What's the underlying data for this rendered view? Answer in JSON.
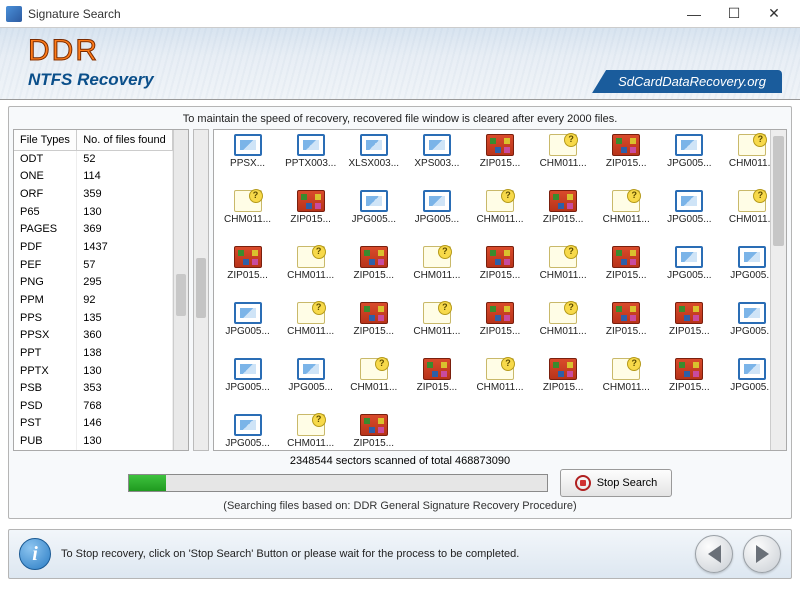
{
  "titlebar": {
    "title": "Signature Search"
  },
  "header": {
    "brand": "DDR",
    "subtitle": "NTFS Recovery",
    "site": "SdCardDataRecovery.org"
  },
  "status_line": "To maintain the speed of recovery, recovered file window is cleared after every 2000 files.",
  "file_types_table": {
    "headers": [
      "File Types",
      "No. of files found"
    ],
    "rows": [
      [
        "ODT",
        "52"
      ],
      [
        "ONE",
        "114"
      ],
      [
        "ORF",
        "359"
      ],
      [
        "P65",
        "130"
      ],
      [
        "PAGES",
        "369"
      ],
      [
        "PDF",
        "1437"
      ],
      [
        "PEF",
        "57"
      ],
      [
        "PNG",
        "295"
      ],
      [
        "PPM",
        "92"
      ],
      [
        "PPS",
        "135"
      ],
      [
        "PPSX",
        "360"
      ],
      [
        "PPT",
        "138"
      ],
      [
        "PPTX",
        "130"
      ],
      [
        "PSB",
        "353"
      ],
      [
        "PSD",
        "768"
      ],
      [
        "PST",
        "146"
      ],
      [
        "PUB",
        "130"
      ]
    ]
  },
  "file_grid": [
    {
      "t": "img",
      "l": "PPSX..."
    },
    {
      "t": "img",
      "l": "PPTX003..."
    },
    {
      "t": "img",
      "l": "XLSX003..."
    },
    {
      "t": "img",
      "l": "XPS003..."
    },
    {
      "t": "zip",
      "l": "ZIP015..."
    },
    {
      "t": "unk",
      "l": "CHM011..."
    },
    {
      "t": "zip",
      "l": "ZIP015..."
    },
    {
      "t": "img",
      "l": "JPG005..."
    },
    {
      "t": "unk",
      "l": "CHM011..."
    },
    {
      "t": "unk",
      "l": "CHM011..."
    },
    {
      "t": "zip",
      "l": "ZIP015..."
    },
    {
      "t": "img",
      "l": "JPG005..."
    },
    {
      "t": "img",
      "l": "JPG005..."
    },
    {
      "t": "unk",
      "l": "CHM011..."
    },
    {
      "t": "zip",
      "l": "ZIP015..."
    },
    {
      "t": "unk",
      "l": "CHM011..."
    },
    {
      "t": "img",
      "l": "JPG005..."
    },
    {
      "t": "unk",
      "l": "CHM011..."
    },
    {
      "t": "zip",
      "l": "ZIP015..."
    },
    {
      "t": "unk",
      "l": "CHM011..."
    },
    {
      "t": "zip",
      "l": "ZIP015..."
    },
    {
      "t": "unk",
      "l": "CHM011..."
    },
    {
      "t": "zip",
      "l": "ZIP015..."
    },
    {
      "t": "unk",
      "l": "CHM011..."
    },
    {
      "t": "zip",
      "l": "ZIP015..."
    },
    {
      "t": "img",
      "l": "JPG005..."
    },
    {
      "t": "img",
      "l": "JPG005..."
    },
    {
      "t": "img",
      "l": "JPG005..."
    },
    {
      "t": "unk",
      "l": "CHM011..."
    },
    {
      "t": "zip",
      "l": "ZIP015..."
    },
    {
      "t": "unk",
      "l": "CHM011..."
    },
    {
      "t": "zip",
      "l": "ZIP015..."
    },
    {
      "t": "unk",
      "l": "CHM011..."
    },
    {
      "t": "zip",
      "l": "ZIP015..."
    },
    {
      "t": "zip",
      "l": "ZIP015..."
    },
    {
      "t": "img",
      "l": "JPG005..."
    },
    {
      "t": "img",
      "l": "JPG005..."
    },
    {
      "t": "img",
      "l": "JPG005..."
    },
    {
      "t": "unk",
      "l": "CHM011..."
    },
    {
      "t": "zip",
      "l": "ZIP015..."
    },
    {
      "t": "unk",
      "l": "CHM011..."
    },
    {
      "t": "zip",
      "l": "ZIP015..."
    },
    {
      "t": "unk",
      "l": "CHM011..."
    },
    {
      "t": "zip",
      "l": "ZIP015..."
    },
    {
      "t": "img",
      "l": "JPG005..."
    },
    {
      "t": "img",
      "l": "JPG005..."
    },
    {
      "t": "unk",
      "l": "CHM011..."
    },
    {
      "t": "zip",
      "l": "ZIP015..."
    }
  ],
  "file_grid_trailing_label": "ZIP015...",
  "progress": {
    "text": "2348544 sectors scanned of total 468873090",
    "note": "(Searching files based on:  DDR General Signature Recovery Procedure)",
    "stop_label": "Stop Search"
  },
  "footer": {
    "hint": "To Stop recovery, click on 'Stop Search' Button or please wait for the process to be completed."
  }
}
